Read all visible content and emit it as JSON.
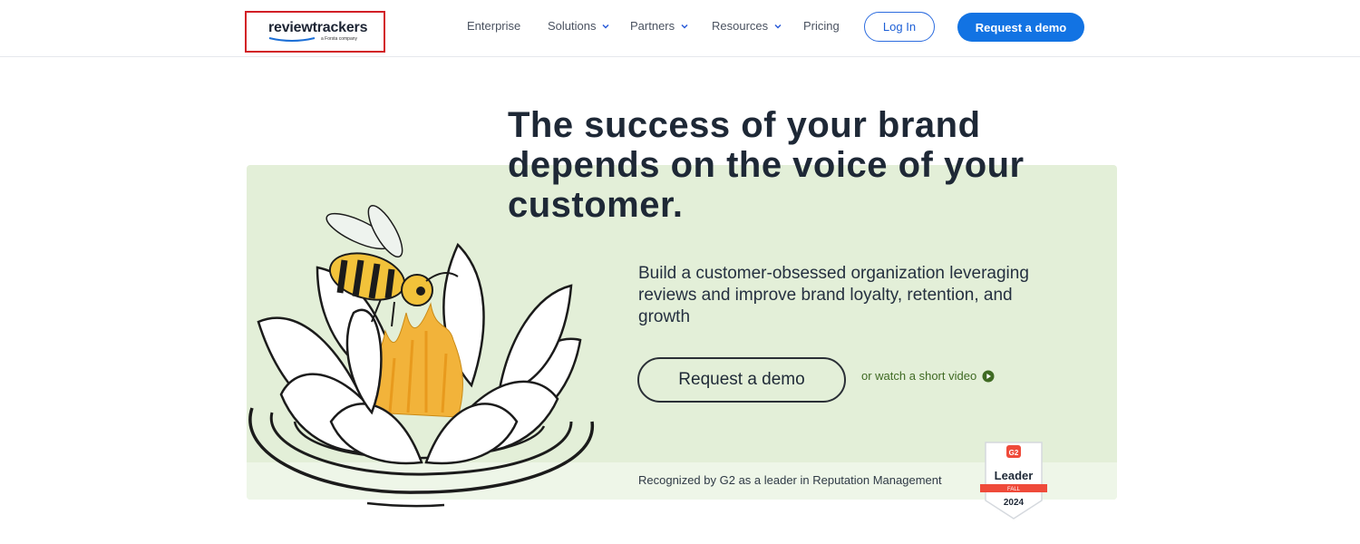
{
  "header": {
    "logo": {
      "name": "reviewtrackers",
      "sub": "a Forsta company"
    },
    "nav": [
      {
        "label": "Enterprise",
        "has_dropdown": false
      },
      {
        "label": "Solutions",
        "has_dropdown": true
      },
      {
        "label": "Partners",
        "has_dropdown": true
      },
      {
        "label": "Resources",
        "has_dropdown": true
      },
      {
        "label": "Pricing",
        "has_dropdown": false
      }
    ],
    "login_label": "Log In",
    "demo_label": "Request a demo"
  },
  "hero": {
    "headline": "The success of your brand depends on the voice of your customer.",
    "subtext": "Build a customer-obsessed organization leveraging reviews and improve brand loyalty, retention, and growth",
    "cta_label": "Request a demo",
    "video_link": "or watch a short video",
    "recognized": "Recognized by G2 as a leader in Reputation Management",
    "badge": {
      "brand": "G2",
      "title": "Leader",
      "season": "FALL",
      "year": "2024"
    }
  },
  "colors": {
    "primary": "#1273e3",
    "hero_bg": "#e3efd8",
    "video_link": "#3f6a23",
    "badge_red": "#ef4a3a",
    "bee_yellow": "#f2b33a"
  },
  "icons": [
    "chevron-down-icon",
    "play-circle-icon",
    "bee-lotus-illustration",
    "g2-badge"
  ]
}
